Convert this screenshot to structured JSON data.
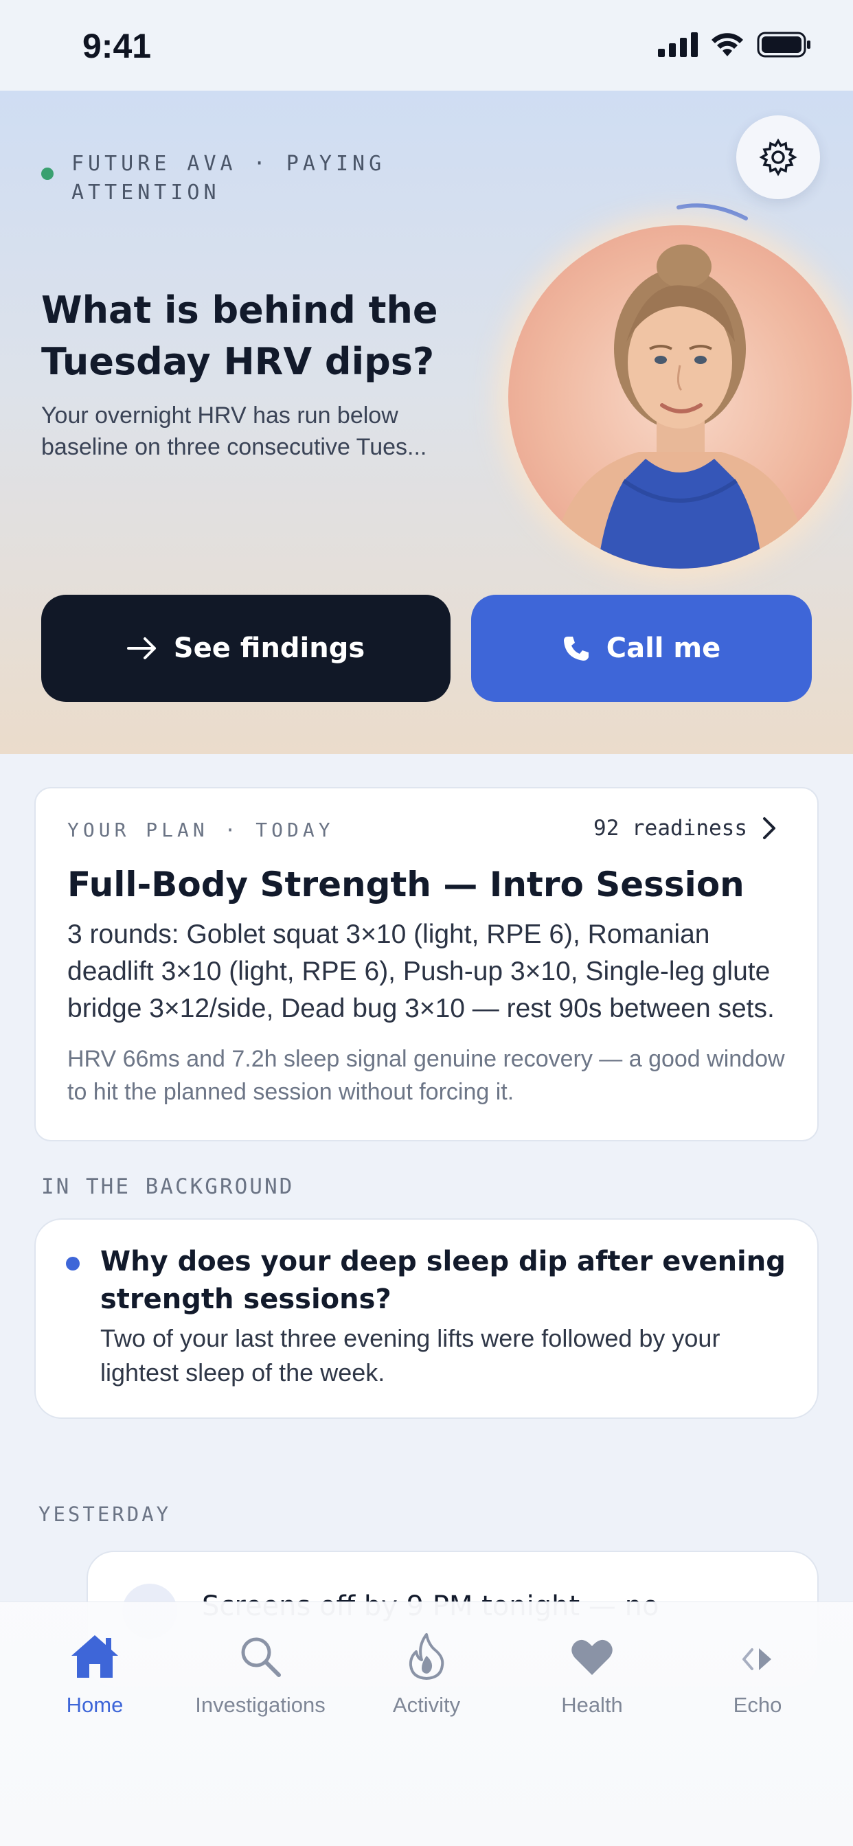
{
  "status_bar": {
    "time": "9:41"
  },
  "hero": {
    "presence_label": "FUTURE AVA · PAYING ATTENTION",
    "title": "What is behind the Tuesday HRV dips?",
    "subtitle": "Your overnight HRV has run below baseline on three consecutive Tues...",
    "primary_button": "See findings",
    "secondary_button": "Call me"
  },
  "plan": {
    "eyebrow": "YOUR PLAN · TODAY",
    "readiness": "92 readiness",
    "title": "Full-Body Strength — Intro Session",
    "body": "3 rounds: Goblet squat 3×10 (light, RPE 6), Romanian deadlift 3×10 (light, RPE 6), Push-up 3×10, Single-leg glute bridge 3×12/side, Dead bug 3×10 — rest 90s between sets.",
    "note": "HRV 66ms and 7.2h sleep signal genuine recovery — a good window to hit the planned session without forcing it."
  },
  "background": {
    "section_label": "IN THE BACKGROUND",
    "title": "Why does your deep sleep dip after evening strength sessions?",
    "body": "Two of your last three evening lifts were followed by your lightest sleep of the week."
  },
  "yesterday": {
    "section_label": "YESTERDAY",
    "item_title": "Screens off by 9 PM tonight — no"
  },
  "tabs": [
    {
      "label": "Home",
      "icon": "home-icon",
      "active": true
    },
    {
      "label": "Investigations",
      "icon": "search-icon",
      "active": false
    },
    {
      "label": "Activity",
      "icon": "flame-icon",
      "active": false
    },
    {
      "label": "Health",
      "icon": "heart-icon",
      "active": false
    },
    {
      "label": "Echo",
      "icon": "echo-icon",
      "active": false
    }
  ],
  "colors": {
    "accent": "#3e66d8",
    "dark_button": "#111827",
    "presence_dot": "#3aa070",
    "page_bg": "#eef2f9"
  }
}
